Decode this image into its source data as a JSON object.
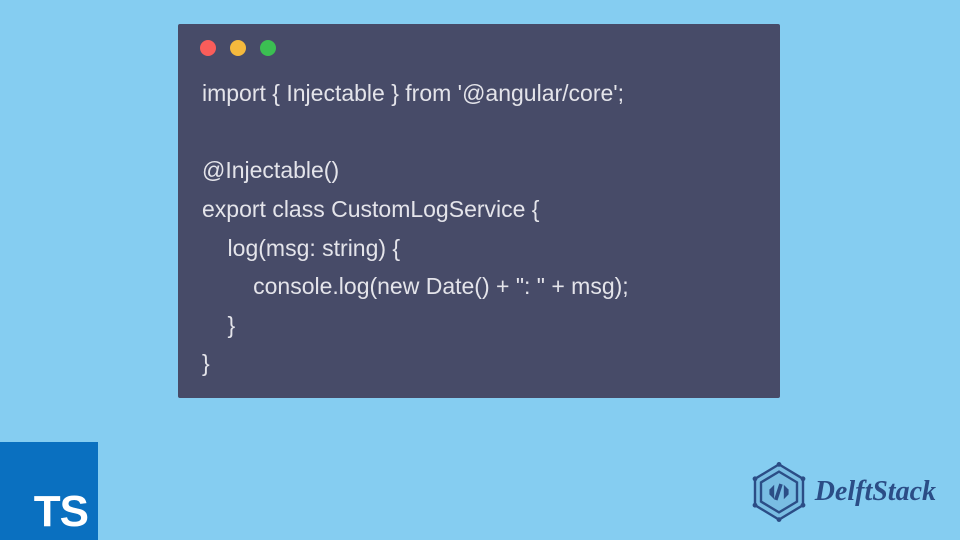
{
  "code": {
    "lines": [
      "import { Injectable } from '@angular/core';",
      "",
      "@Injectable()",
      "export class CustomLogService {",
      "    log(msg: string) {",
      "        console.log(new Date() + \": \" + msg);",
      "    }",
      "}"
    ]
  },
  "ts_badge": "TS",
  "brand": {
    "name": "DelftStack"
  },
  "colors": {
    "background": "#85cdf1",
    "window": "#474b68",
    "text": "#e4e4ea",
    "ts_badge_bg": "#0a70c0",
    "brand_text": "#2b4d86"
  }
}
